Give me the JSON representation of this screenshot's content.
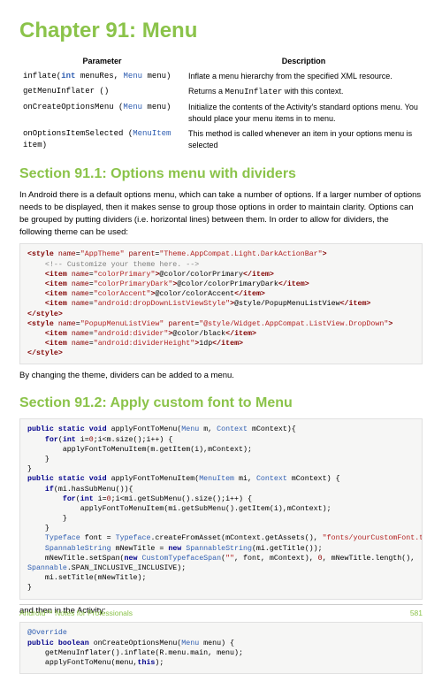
{
  "title": "Chapter 91: Menu",
  "table": {
    "headers": {
      "param": "Parameter",
      "desc": "Description"
    },
    "rows": [
      {
        "p1": "inflate(",
        "p2": "int",
        "p3": " menuRes, ",
        "p4": "Menu",
        "p5": " menu)",
        "desc": "Inflate a menu hierarchy from the specified XML resource."
      },
      {
        "p1": "getMenuInflater ()",
        "desc_pre": "Returns a ",
        "desc_code": "MenuInflater",
        "desc_post": " with this context."
      },
      {
        "p1": "onCreateOptionsMenu (",
        "p2": "Menu",
        "p3": " menu)",
        "desc": "Initialize the contents of the Activity's standard options menu. You should place your menu items in to menu."
      },
      {
        "p1": "onOptionsItemSelected (",
        "p2": "MenuItem",
        "p3": " item)",
        "desc": "This method is called whenever an item in your options menu is selected"
      }
    ]
  },
  "section1": {
    "heading": "Section 91.1: Options menu with dividers",
    "intro": "In Android there is a default options menu, which can take a number of options. If a larger number of options needs to be displayed, then it makes sense to group those options in order to maintain clarity. Options can be grouped by putting dividers (i.e. horizontal lines) between them. In order to allow for dividers, the following theme can be used:",
    "outro": "By changing the theme, dividers can be added to a menu."
  },
  "section2": {
    "heading": "Section 91.2: Apply custom font to Menu",
    "outro": "and then in the Activity:"
  },
  "footer": {
    "left": "Android™ Notes for Professionals",
    "right": "581"
  }
}
